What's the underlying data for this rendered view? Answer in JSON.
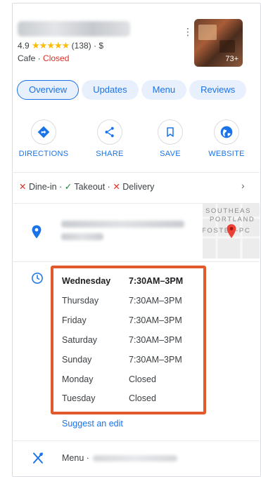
{
  "place": {
    "rating": "4.9",
    "stars": "★★★★★",
    "review_count": "(138)",
    "price": "$",
    "category": "Cafe",
    "status": "Closed",
    "photo_count": "73+"
  },
  "tabs": [
    {
      "label": "Overview",
      "active": true
    },
    {
      "label": "Updates"
    },
    {
      "label": "Menu"
    },
    {
      "label": "Reviews"
    }
  ],
  "actions": [
    {
      "label": "DIRECTIONS",
      "icon": "directions-icon"
    },
    {
      "label": "SHARE",
      "icon": "share-icon"
    },
    {
      "label": "SAVE",
      "icon": "bookmark-icon"
    },
    {
      "label": "WEBSITE",
      "icon": "globe-icon"
    }
  ],
  "service_options": [
    {
      "mark": "✕",
      "label": "Dine-in",
      "available": false
    },
    {
      "mark": "✓",
      "label": "Takeout",
      "available": true
    },
    {
      "mark": "✕",
      "label": "Delivery",
      "available": false
    }
  ],
  "map": {
    "line1": "SOUTHEAS",
    "line2": "PORTLAND",
    "line3": "FOSTER-PC"
  },
  "hours": [
    {
      "day": "Wednesday",
      "time": "7:30AM–3PM",
      "today": true
    },
    {
      "day": "Thursday",
      "time": "7:30AM–3PM"
    },
    {
      "day": "Friday",
      "time": "7:30AM–3PM"
    },
    {
      "day": "Saturday",
      "time": "7:30AM–3PM"
    },
    {
      "day": "Sunday",
      "time": "7:30AM–3PM"
    },
    {
      "day": "Monday",
      "time": "Closed"
    },
    {
      "day": "Tuesday",
      "time": "Closed"
    }
  ],
  "suggest_edit": "Suggest an edit",
  "menu_label": "Menu ·",
  "colors": {
    "accent": "#1a73e8",
    "closed": "#d93025",
    "available": "#188038",
    "highlight_box": "#e05a2b"
  }
}
